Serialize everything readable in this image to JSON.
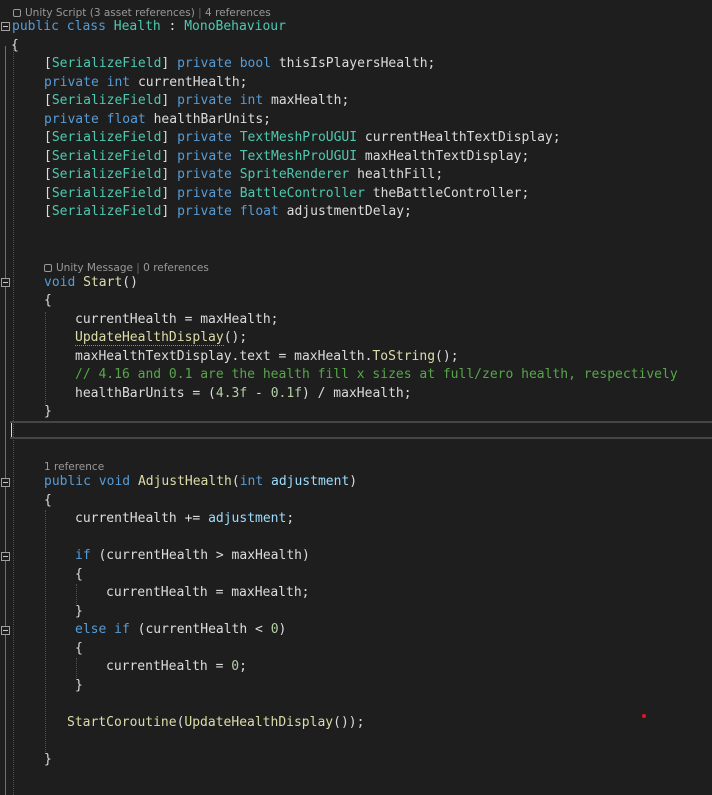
{
  "codelens": {
    "class_lens": {
      "kind": "Unity Script (3 asset references)",
      "refs": "4 references"
    },
    "start_lens": {
      "kind": "Unity Message",
      "refs": "0 references"
    },
    "adjust_lens": {
      "refs": "1 reference"
    }
  },
  "code": {
    "class_decl": {
      "kw1": "public",
      "kw2": "class",
      "name": "Health",
      "colon": " : ",
      "base": "MonoBehaviour"
    },
    "open_brace": "{",
    "fields": [
      {
        "attr": "[SerializeField]",
        "mod": "private",
        "type": "bool",
        "name": "thisIsPlayersHealth;"
      },
      {
        "attr": "",
        "mod": "private",
        "type": "int",
        "name": "currentHealth;"
      },
      {
        "attr": "[SerializeField]",
        "mod": "private",
        "type": "int",
        "name": "maxHealth;"
      },
      {
        "attr": "",
        "mod": "private",
        "type": "float",
        "name": "healthBarUnits;"
      },
      {
        "attr": "[SerializeField]",
        "mod": "private",
        "type": "TextMeshProUGUI",
        "name": "currentHealthTextDisplay;"
      },
      {
        "attr": "[SerializeField]",
        "mod": "private",
        "type": "TextMeshProUGUI",
        "name": "maxHealthTextDisplay;"
      },
      {
        "attr": "[SerializeField]",
        "mod": "private",
        "type": "SpriteRenderer",
        "name": "healthFill;"
      },
      {
        "attr": "[SerializeField]",
        "mod": "private",
        "type": "BattleController",
        "name": "theBattleController;"
      },
      {
        "attr": "[SerializeField]",
        "mod": "private",
        "type": "float",
        "name": "adjustmentDelay;"
      }
    ],
    "start": {
      "kw": "void",
      "name": "Start",
      "parens": "()",
      "open": "{",
      "line1": "currentHealth = maxHealth;",
      "line2_fn": "UpdateHealthDisplay",
      "line2_rest": "();",
      "line3_a": "maxHealthTextDisplay.text = maxHealth.",
      "line3_fn": "ToString",
      "line3_b": "();",
      "comment": "// 4.16 and 0.1 are the health fill x sizes at full/zero health, respectively",
      "line5_a": "healthBarUnits = (",
      "line5_n1": "4.3f",
      "line5_b": " - ",
      "line5_n2": "0.1f",
      "line5_c": ") / maxHealth;",
      "close": "}"
    },
    "adjust": {
      "kw1": "public",
      "kw2": "void",
      "name": "AdjustHealth",
      "open_paren": "(",
      "ptype": "int",
      "pname": "adjustment",
      "close_paren": ")",
      "open": "{",
      "stmt1_a": "currentHealth += ",
      "stmt1_p": "adjustment",
      "stmt1_b": ";",
      "if_kw": "if",
      "if_cond": " (currentHealth > maxHealth)",
      "if_open": "{",
      "if_body": "currentHealth = maxHealth;",
      "if_close": "}",
      "else_kw": "else if",
      "else_cond_a": " (currentHealth < ",
      "else_cond_n": "0",
      "else_cond_b": ")",
      "else_open": "{",
      "else_body_a": "currentHealth = ",
      "else_body_n": "0",
      "else_body_b": ";",
      "else_close": "}",
      "coroutine_fn": "StartCoroutine",
      "coroutine_p1": "(",
      "coroutine_fn2": "UpdateHealthDisplay",
      "coroutine_rest": "());",
      "close": "}"
    }
  },
  "colors": {
    "background": "#1e1e1e",
    "keyword": "#569cd6",
    "type": "#4ec9b0",
    "function": "#dcdcaa",
    "comment": "#57a64a",
    "number": "#b5cea8"
  }
}
